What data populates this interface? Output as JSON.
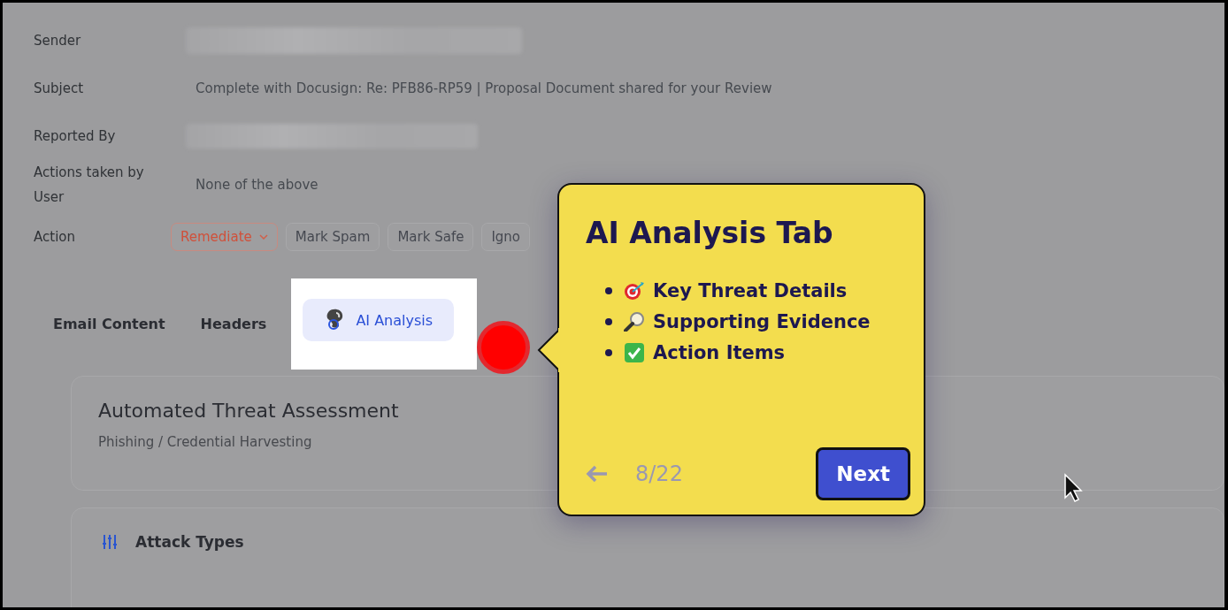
{
  "details": [
    {
      "label": "Sender",
      "kind": "redacted"
    },
    {
      "label": "Subject",
      "kind": "text",
      "value": "Complete with Docusign: Re: PFB86-RP59 | Proposal Document shared for your Review"
    },
    {
      "label": "Reported By",
      "kind": "redacted"
    },
    {
      "label": "Actions taken by User",
      "kind": "text",
      "value": "None of the above"
    }
  ],
  "action": {
    "label": "Action",
    "buttons": [
      {
        "label": "Remediate",
        "kind": "dropdown"
      },
      {
        "label": "Mark Spam",
        "kind": "button"
      },
      {
        "label": "Mark Safe",
        "kind": "button"
      },
      {
        "label": "Igno",
        "kind": "button"
      }
    ]
  },
  "tabs": [
    {
      "label": "Email Content",
      "selected": false,
      "highlighted": false
    },
    {
      "label": "Headers",
      "selected": false,
      "highlighted": false
    },
    {
      "label": "AI Analysis",
      "selected": true,
      "highlighted": true
    }
  ],
  "assessment": {
    "title": "Automated Threat Assessment",
    "subtitle": "Phishing / Credential Harvesting"
  },
  "attack_types": {
    "title": "Attack Types"
  },
  "tour": {
    "title": "AI Analysis Tab",
    "items": [
      {
        "kind": "target",
        "text": "Key Threat Details"
      },
      {
        "kind": "magnifier",
        "text": "Supporting Evidence"
      },
      {
        "kind": "check",
        "text": "Action Items"
      }
    ],
    "step": "8/22",
    "back_disabled": true,
    "next": "Next"
  }
}
